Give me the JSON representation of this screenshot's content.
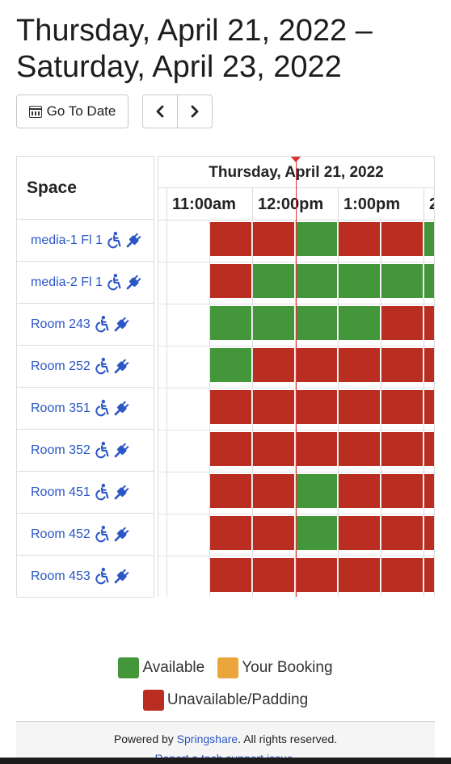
{
  "header": {
    "title": "Thursday, April 21, 2022 – Saturday, April 23, 2022"
  },
  "toolbar": {
    "go_to_date_label": "Go To Date",
    "prev_icon": "chevron-left-icon",
    "next_icon": "chevron-right-icon",
    "prev_label": "‹",
    "next_label": "›"
  },
  "grid": {
    "space_header": "Space",
    "day_label": "Thursday, April 21, 2022",
    "time_labels": [
      "11:00am",
      "12:00pm",
      "1:00pm",
      "2"
    ],
    "spaces": [
      {
        "name": "media-1 Fl 1",
        "slots": [
          "empty",
          "U",
          "U",
          "A",
          "U",
          "U",
          "A"
        ]
      },
      {
        "name": "media-2 Fl 1",
        "slots": [
          "empty",
          "U",
          "A",
          "A",
          "A",
          "A",
          "A"
        ]
      },
      {
        "name": "Room 243",
        "slots": [
          "empty",
          "A",
          "A",
          "A",
          "A",
          "U",
          "U"
        ]
      },
      {
        "name": "Room 252",
        "slots": [
          "empty",
          "A",
          "U",
          "U",
          "U",
          "U",
          "U"
        ]
      },
      {
        "name": "Room 351",
        "slots": [
          "empty",
          "U",
          "U",
          "U",
          "U",
          "U",
          "U"
        ]
      },
      {
        "name": "Room 352",
        "slots": [
          "empty",
          "U",
          "U",
          "U",
          "U",
          "U",
          "U"
        ]
      },
      {
        "name": "Room 451",
        "slots": [
          "empty",
          "U",
          "U",
          "A",
          "U",
          "U",
          "U"
        ]
      },
      {
        "name": "Room 452",
        "slots": [
          "empty",
          "U",
          "U",
          "A",
          "U",
          "U",
          "U"
        ]
      },
      {
        "name": "Room 453",
        "slots": [
          "empty",
          "U",
          "U",
          "U",
          "U",
          "U",
          "U"
        ]
      }
    ],
    "icons": [
      "accessible-icon",
      "power-plug-icon"
    ]
  },
  "legend": {
    "available": "Available",
    "your_booking": "Your Booking",
    "unavailable": "Unavailable/Padding"
  },
  "colors": {
    "available": "#43973a",
    "your_booking": "#eaa63a",
    "unavailable": "#ba2e21",
    "link": "#2a56c6",
    "now": "#e03030"
  },
  "footer": {
    "powered_prefix": "Powered by",
    "brand": "Springshare",
    "rights": ". All rights reserved.",
    "report": "Report a tech support issue."
  }
}
